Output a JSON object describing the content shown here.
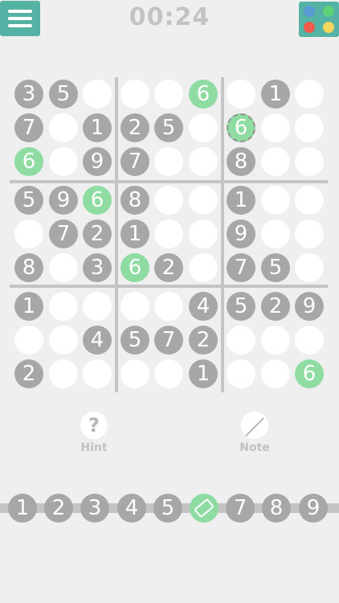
{
  "timer": "00:24",
  "theme_colors": [
    "#5b9bd5",
    "#5fd17a",
    "#f05a4c",
    "#f4d75c"
  ],
  "board": [
    [
      "3",
      "5",
      "",
      "",
      "",
      "6",
      "",
      "1",
      ""
    ],
    [
      "7",
      "",
      "1",
      "2",
      "5",
      "",
      "6",
      "",
      ""
    ],
    [
      "6",
      "",
      "9",
      "7",
      "",
      "",
      "8",
      "",
      ""
    ],
    [
      "5",
      "9",
      "6",
      "8",
      "",
      "",
      "1",
      "",
      ""
    ],
    [
      "",
      "7",
      "2",
      "1",
      "",
      "",
      "9",
      "",
      ""
    ],
    [
      "8",
      "",
      "3",
      "6",
      "2",
      "",
      "7",
      "5",
      ""
    ],
    [
      "1",
      "",
      "",
      "",
      "",
      "4",
      "5",
      "2",
      "9"
    ],
    [
      "",
      "",
      "4",
      "5",
      "7",
      "2",
      "",
      "",
      ""
    ],
    [
      "2",
      "",
      "",
      "",
      "",
      "1",
      "",
      "",
      "6"
    ]
  ],
  "highlight_digit": "6",
  "selected_cell": [
    1,
    6
  ],
  "tools": {
    "hint": {
      "label": "Hint",
      "icon": "?"
    },
    "note": {
      "label": "Note",
      "icon": "／"
    }
  },
  "number_pad": [
    "1",
    "2",
    "3",
    "4",
    "5",
    "",
    "7",
    "8",
    "9"
  ],
  "number_pad_active_index": 5
}
